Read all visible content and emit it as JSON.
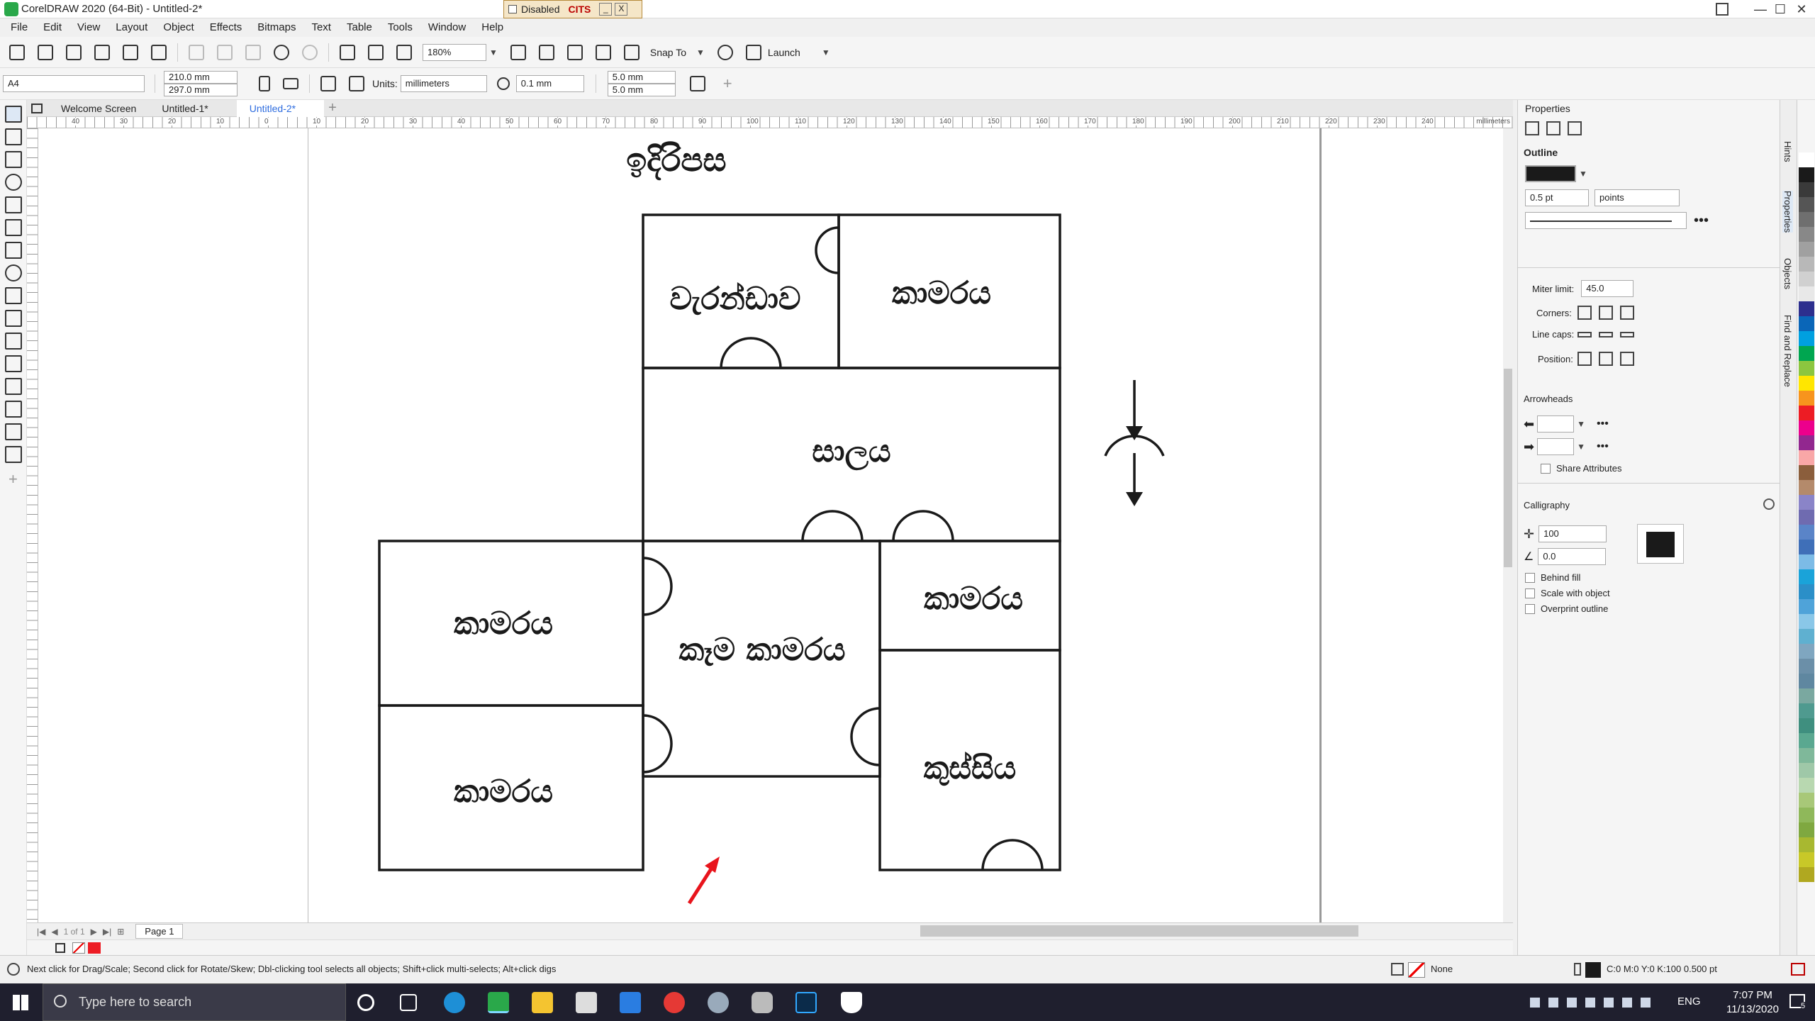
{
  "window": {
    "title": "CorelDRAW 2020 (64-Bit) - Untitled-2*",
    "banner_status": "Disabled",
    "banner_name": "CITS",
    "minimize": "—",
    "maximize": "☐",
    "close": "✕"
  },
  "menu": {
    "items": [
      "File",
      "Edit",
      "View",
      "Layout",
      "Object",
      "Effects",
      "Bitmaps",
      "Text",
      "Table",
      "Tools",
      "Window",
      "Help"
    ]
  },
  "toolbar": {
    "zoom": "180%",
    "snap_to": "Snap To",
    "launch": "Launch"
  },
  "propertybar": {
    "page_size": "A4",
    "width": "210.0 mm",
    "height": "297.0 mm",
    "units_label": "Units:",
    "units_value": "millimeters",
    "nudge": "0.1 mm",
    "dup_x": "5.0 mm",
    "dup_y": "5.0 mm"
  },
  "tabs": [
    "Welcome Screen",
    "Untitled-1*",
    "Untitled-2*"
  ],
  "ruler": {
    "top_labels": [
      "40",
      "30",
      "20",
      "10",
      "0",
      "10",
      "20",
      "30",
      "40",
      "50",
      "60",
      "70",
      "80",
      "90",
      "100",
      "110",
      "120",
      "130",
      "140",
      "150",
      "160",
      "170",
      "180",
      "190",
      "200",
      "210",
      "220",
      "230",
      "240"
    ],
    "unit": "millimeters"
  },
  "drawing": {
    "title": "ඉදිරිපස",
    "rooms": {
      "veranda": "වැරන්ඩාව",
      "room_top": "කාමරය",
      "hall": "සාලය",
      "room_left_top": "කාමරය",
      "dining": "කෑම කාමරය",
      "room_right": "කාමරය",
      "room_left_bottom": "කාමරය",
      "kitchen": "කුස්සිය"
    }
  },
  "pagenav": {
    "count": "1 of 1",
    "page": "Page 1"
  },
  "docker": {
    "title": "Properties",
    "outline_header": "Outline",
    "outline_color": "#1a1a1a",
    "width_value": "0.5 pt",
    "width_unit": "points",
    "miter_label": "Miter limit:",
    "miter_value": "45.0",
    "corners_label": "Corners:",
    "linecaps_label": "Line caps:",
    "position_label": "Position:",
    "arrowheads_header": "Arrowheads",
    "share_attributes": "Share Attributes",
    "calligraphy_header": "Calligraphy",
    "stretch_value": "100",
    "angle_value": "0.0",
    "behind_fill": "Behind fill",
    "scale_with_object": "Scale with object",
    "overprint_outline": "Overprint outline"
  },
  "sidetabs": [
    "Hints",
    "Properties",
    "Objects",
    "Find and Replace"
  ],
  "palette_colors": [
    "#ffffff",
    "#1a1a1a",
    "#3a3a3a",
    "#555555",
    "#6f6f6f",
    "#888888",
    "#a0a0a0",
    "#b8b8b8",
    "#d0d0d0",
    "#e8e8e8",
    "#2d2f8e",
    "#0a66b8",
    "#00a0e0",
    "#00a650",
    "#8cc63f",
    "#ffe600",
    "#f7941d",
    "#ed1c24",
    "#ec008c",
    "#92278f",
    "#f9a7a7",
    "#8b5e3c",
    "#b48a6b",
    "#8a84c8",
    "#6f6bb0",
    "#5a84c8",
    "#3f6fb8",
    "#7cbbe6",
    "#1aa3d9",
    "#2b8fc8",
    "#4fa3d9",
    "#8ac7e8",
    "#5fb0d0",
    "#7fa6c0",
    "#6b8fa8",
    "#5f87a0",
    "#7aa8a0",
    "#4f9a8f",
    "#3f8f7f",
    "#5aa890",
    "#7fb89a",
    "#9fc8a8",
    "#b8d8b0",
    "#a8c878",
    "#8fb85a",
    "#7fa840",
    "#a8b830",
    "#c8c828",
    "#b0a820"
  ],
  "status": {
    "hint": "Next click for Drag/Scale; Second click for Rotate/Skew; Dbl-clicking tool selects all objects; Shift+click multi-selects; Alt+click digs",
    "fill": "None",
    "outline_info": "C:0 M:0 Y:0 K:100  0.500 pt"
  },
  "taskbar": {
    "search_placeholder": "Type here to search",
    "language": "ENG",
    "time": "7:07 PM",
    "date": "11/13/2020",
    "notifications": "5"
  }
}
